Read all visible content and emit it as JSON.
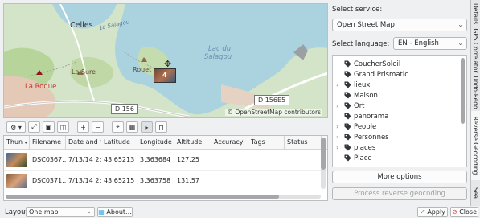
{
  "map": {
    "labels": {
      "celles": "Celles",
      "salagou": "Le Salagou",
      "lac": "Lac du",
      "lac2": "Salagou",
      "la_sure": "La Sure",
      "rouet": "Rouet",
      "la_roque": "La Roque",
      "d156": "D 156",
      "d156e5": "D 156E5"
    },
    "attribution": "© OpenStreetMap contributors",
    "marker_label": "4"
  },
  "map_toolbar": {
    "icons": [
      "gear-icon",
      "expand-icon",
      "image-icon",
      "image-frame-icon",
      "zoom-in-icon",
      "zoom-out-icon",
      "crosshair-icon",
      "grid-icon",
      "play-icon",
      "bookmark-icon"
    ]
  },
  "table": {
    "headers": [
      "Thun",
      "Filename",
      "Date and tim",
      "Latitude",
      "Longitude",
      "Altitude",
      "Accuracy",
      "Tags",
      "Status"
    ],
    "rows": [
      {
        "filename": "DSC0367...",
        "date": "7/13/14 2:...",
        "latitude": "43.65213",
        "longitude": "3.363684",
        "altitude": "127.25",
        "accuracy": "",
        "tags": "",
        "status": ""
      },
      {
        "filename": "DSC0371...",
        "date": "7/13/14 2:...",
        "latitude": "43.65215",
        "longitude": "3.363758",
        "altitude": "131.57",
        "accuracy": "",
        "tags": "",
        "status": ""
      }
    ]
  },
  "bottom": {
    "layout_label": "Layout:",
    "layout_value": "One map",
    "about_label": "About...",
    "apply_label": "Apply",
    "close_label": "Close"
  },
  "right": {
    "service_label": "Select service:",
    "service_value": "Open Street Map",
    "language_label": "Select language:",
    "language_value": "EN - English",
    "tree_items": [
      {
        "label": "CoucherSoleil",
        "expandable": false
      },
      {
        "label": "Grand Prismatic",
        "expandable": false
      },
      {
        "label": "lieux",
        "expandable": true
      },
      {
        "label": "Maison",
        "expandable": false
      },
      {
        "label": "Ort",
        "expandable": true
      },
      {
        "label": "panorama",
        "expandable": false
      },
      {
        "label": "People",
        "expandable": true
      },
      {
        "label": "Personnes",
        "expandable": true
      },
      {
        "label": "places",
        "expandable": true
      },
      {
        "label": "Place",
        "expandable": false
      }
    ],
    "more_options": "More options",
    "process": "Process reverse geocoding"
  },
  "side_tabs": [
    "Details",
    "GPS Correlator",
    "Undo-Redo",
    "Reverse Geocoding",
    "Sea"
  ],
  "colors": {
    "accent": "#3daee9",
    "close_red": "#da4453",
    "apply_green": "#27ae60"
  }
}
